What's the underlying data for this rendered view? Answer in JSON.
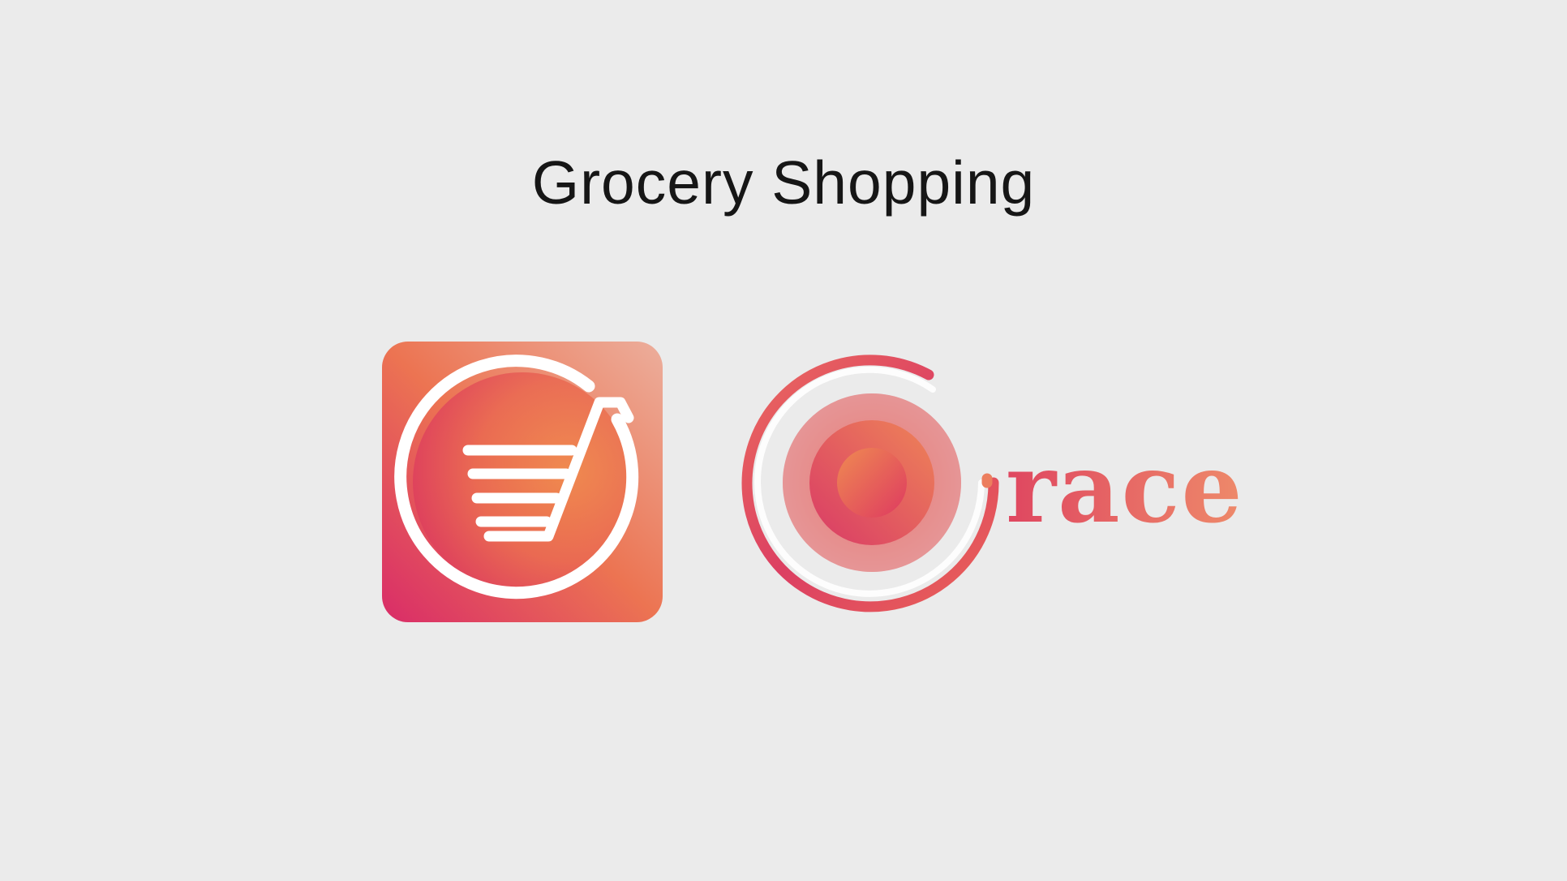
{
  "page": {
    "title": "Grocery Shopping",
    "background_color": "#ebebeb"
  },
  "logos": {
    "app_icon": {
      "icon": "shopping-cart-icon",
      "gradient_colors": [
        "#d93268",
        "#ee7a52",
        "#efaf98"
      ]
    },
    "brand_logo": {
      "icon": "spiral-target-icon",
      "wordmark_text": "race",
      "colors": [
        "#d8355f",
        "#ec8060",
        "#eca48f"
      ]
    }
  }
}
